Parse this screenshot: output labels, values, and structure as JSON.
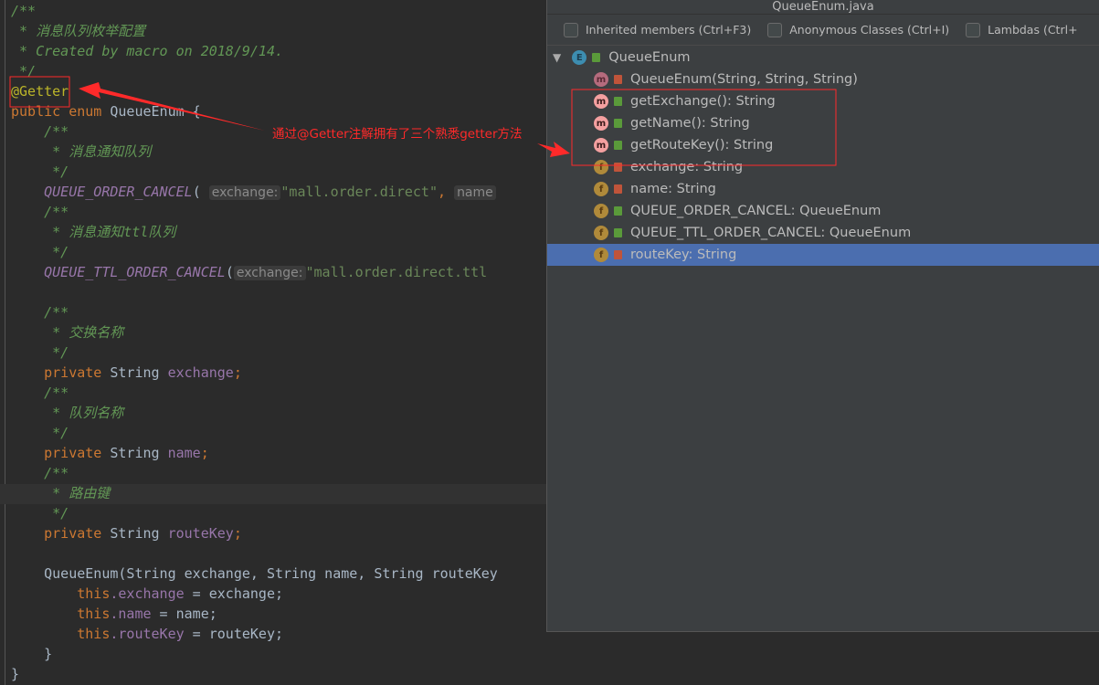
{
  "editor": {
    "lines": {
      "l1": "/**",
      "l2": " * 消息队列枚举配置",
      "l3": " * Created by macro on 2018/9/14.",
      "l4": " */",
      "l5": "@Getter",
      "l6a": "public enum ",
      "l6b": "QueueEnum {",
      "l7": "    /**",
      "l8": "     * 消息通知队列",
      "l9": "     */",
      "l10a": "    QUEUE_ORDER_CANCEL",
      "l10b": "(",
      "l10hint1": "exchange:",
      "l10c": "\"mall.order.direct\"",
      "l10d": ", ",
      "l10hint2": "name",
      "l11": "    /**",
      "l12": "     * 消息通知ttl队列",
      "l13": "     */",
      "l14a": "    QUEUE_TTL_ORDER_CANCEL",
      "l14b": "(",
      "l14hint1": "exchange:",
      "l14c": "\"mall.order.direct.ttl",
      "l16": "    /**",
      "l17": "     * 交换名称",
      "l18": "     */",
      "l19a": "    private ",
      "l19b": "String ",
      "l19c": "exchange",
      "l19d": ";",
      "l20": "    /**",
      "l21": "     * 队列名称",
      "l22": "     */",
      "l23a": "    private ",
      "l23b": "String ",
      "l23c": "name",
      "l23d": ";",
      "l24": "    /**",
      "l25": "     * 路由键",
      "l26": "     */",
      "l27a": "    private ",
      "l27b": "String ",
      "l27c": "routeKey",
      "l27d": ";",
      "l29": "    QueueEnum(String exchange, String name, String routeKey",
      "l30a": "        this",
      "l30b": ".exchange",
      "l30c": " = exchange;",
      "l31a": "        this",
      "l31b": ".name",
      "l31c": " = name;",
      "l32a": "        this",
      "l32b": ".routeKey",
      "l32c": " = routeKey;",
      "l33": "    }",
      "l34": "}"
    }
  },
  "annotation": "通过@Getter注解拥有了三个熟悉getter方法",
  "structure_popup": {
    "title": "QueueEnum.java",
    "filters": [
      "Inherited members (Ctrl+F3)",
      "Anonymous Classes (Ctrl+I)",
      "Lambdas (Ctrl+"
    ],
    "root": "QueueEnum",
    "items": [
      {
        "label": "QueueEnum(String, String, String)",
        "icon": "method-icon",
        "access": "private"
      },
      {
        "label": "getExchange(): String",
        "icon": "method-icon",
        "access": "public"
      },
      {
        "label": "getName(): String",
        "icon": "method-icon",
        "access": "public"
      },
      {
        "label": "getRouteKey(): String",
        "icon": "method-icon",
        "access": "public"
      },
      {
        "label": "exchange: String",
        "icon": "field-icon",
        "access": "private"
      },
      {
        "label": "name: String",
        "icon": "field-icon",
        "access": "private"
      },
      {
        "label": "QUEUE_ORDER_CANCEL: QueueEnum",
        "icon": "field-icon",
        "access": "public"
      },
      {
        "label": "QUEUE_TTL_ORDER_CANCEL: QueueEnum",
        "icon": "field-icon",
        "access": "public"
      },
      {
        "label": "routeKey: String",
        "icon": "field-icon",
        "access": "private",
        "selected": true
      }
    ]
  },
  "colors": {
    "annotation_red": "#ff2a2a",
    "selection": "#4b6eaf"
  }
}
